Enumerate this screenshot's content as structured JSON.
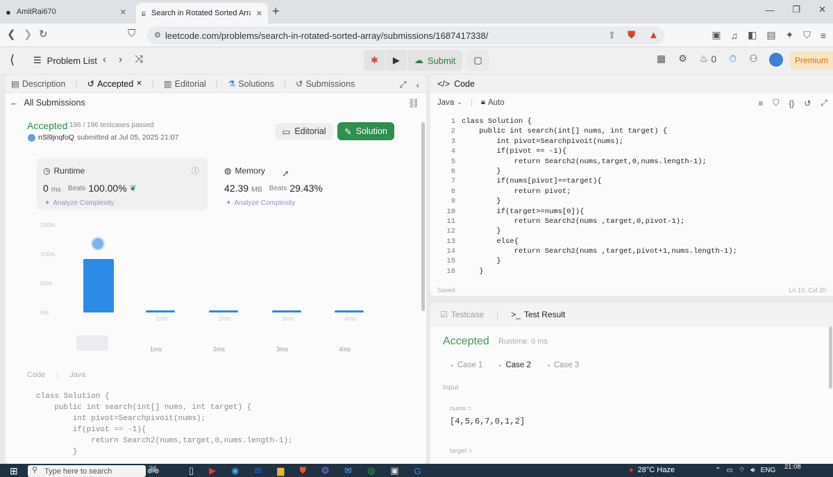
{
  "browser": {
    "tabs": [
      {
        "title": "AmitRai670",
        "active": false
      },
      {
        "title": "Search in Rotated Sorted Array -",
        "active": true
      }
    ],
    "url": "leetcode.com/problems/search-in-rotated-sorted-array/submissions/1687417338/"
  },
  "header": {
    "problem_list": "Problem List",
    "submit": "Submit",
    "streak": "0",
    "premium": "Premium"
  },
  "left": {
    "tabs": [
      "Description",
      "Accepted",
      "Editorial",
      "Solutions",
      "Submissions"
    ],
    "all_submissions": "All Submissions",
    "status": "Accepted",
    "testcases": "196 / 196 testcases passed",
    "user": "nSl9jnqfoQ",
    "submitted": "submitted at Jul 05, 2025 21:07",
    "editorial_btn": "Editorial",
    "solution_btn": "Solution",
    "runtime": {
      "title": "Runtime",
      "value": "0",
      "unit": "ms",
      "beats": "Beats",
      "pct": "100.00%",
      "analyze": "Analyze Complexity"
    },
    "memory": {
      "title": "Memory",
      "value": "42.39",
      "unit": "MB",
      "beats": "Beats",
      "pct": "29.43%",
      "analyze": "Analyze Complexity"
    },
    "code_tab": "Code",
    "code_lang": "Java",
    "code_lines": [
      "class Solution {",
      "    public int search(int[] nums, int target) {",
      "        int pivot=Searchpivoit(nums);",
      "        if(pivot == -1){",
      "            return Search2(nums,target,0,nums.length-1);",
      "        }"
    ]
  },
  "chart_data": {
    "type": "bar",
    "categories": [
      "0ms",
      "1ms",
      "2ms",
      "3ms",
      "4ms"
    ],
    "values": [
      100,
      2,
      2,
      2,
      2
    ],
    "xticklabels": [
      "",
      "1ms",
      "2ms",
      "3ms",
      "4ms"
    ],
    "yticks": [
      "150%",
      "100%",
      "50%",
      "0%"
    ],
    "ylim": [
      0,
      150
    ],
    "bar_color": "#2d8ae6"
  },
  "editor": {
    "title": "Code",
    "lang": "Java",
    "mode": "Auto",
    "lines": [
      "class Solution {",
      "    public int search(int[] nums, int target) {",
      "        int pivot=Searchpivoit(nums);",
      "        if(pivot == -1){",
      "            return Search2(nums,target,0,nums.length-1);",
      "        }",
      "        if(nums[pivot]==target){",
      "            return pivot;",
      "        }",
      "        if(target>=nums[0]){",
      "            return Search2(nums ,target,0,pivot-1);",
      "        }",
      "        else{",
      "            return Search2(nums ,target,pivot+1,nums.length-1);",
      "        }",
      "    }"
    ],
    "saved": "Saved",
    "position": "Ln 10, Col 20"
  },
  "result": {
    "tab_testcase": "Testcase",
    "tab_result": "Test Result",
    "status": "Accepted",
    "runtime": "Runtime: 0 ms",
    "cases": [
      "Case 1",
      "Case 2",
      "Case 3"
    ],
    "active_case": 1,
    "input_label": "Input",
    "nums_label": "nums =",
    "nums_value": "[4,5,6,7,0,1,2]",
    "target_label": "target ="
  },
  "taskbar": {
    "search_placeholder": "Type here to search",
    "weather": "28°C  Haze",
    "lang": "ENG",
    "time": "21:08"
  }
}
